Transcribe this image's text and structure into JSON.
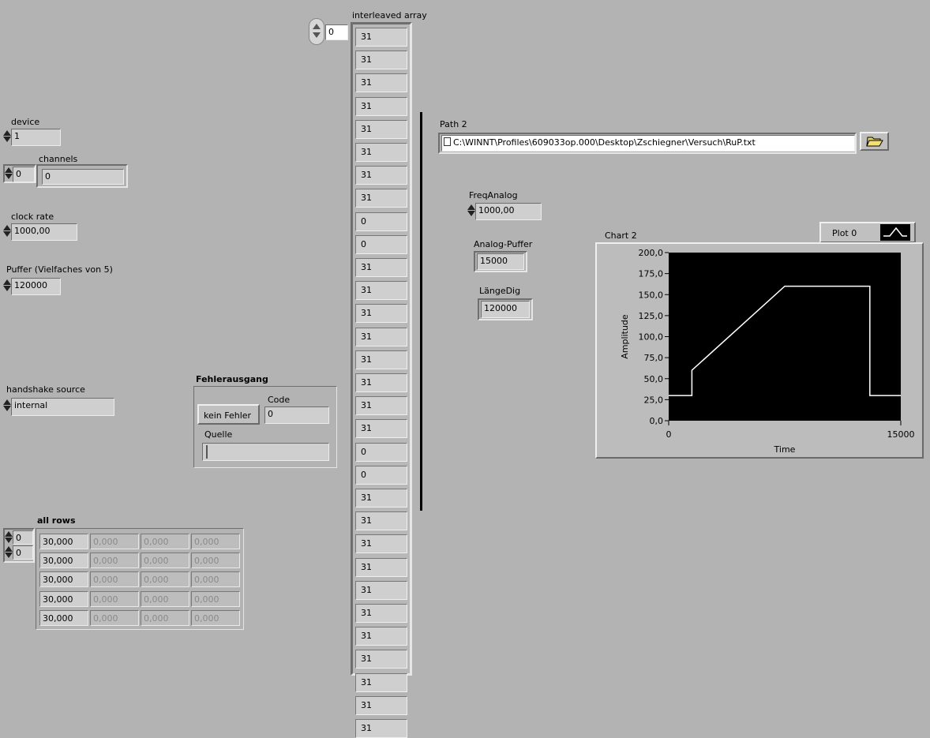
{
  "device": {
    "label": "device",
    "value": "1"
  },
  "channels": {
    "label": "channels",
    "index": "0",
    "value": "0"
  },
  "clock_rate": {
    "label": "clock rate",
    "value": "1000,00"
  },
  "puffer": {
    "label": "Puffer (Vielfaches von 5)",
    "value": "120000"
  },
  "handshake": {
    "label": "handshake source",
    "value": "internal"
  },
  "error_cluster": {
    "title": "Fehlerausgang",
    "code_label": "Code",
    "code_value": "0",
    "status_label": "kein Fehler",
    "source_label": "Quelle",
    "source_value": ""
  },
  "all_rows": {
    "label": "all rows",
    "index_row": "0",
    "index_col": "0",
    "rows": [
      [
        "30,000",
        "0,000",
        "0,000",
        "0,000"
      ],
      [
        "30,000",
        "0,000",
        "0,000",
        "0,000"
      ],
      [
        "30,000",
        "0,000",
        "0,000",
        "0,000"
      ],
      [
        "30,000",
        "0,000",
        "0,000",
        "0,000"
      ],
      [
        "30,000",
        "0,000",
        "0,000",
        "0,000"
      ]
    ]
  },
  "interleaved": {
    "label": "interleaved array",
    "index": "0",
    "values": [
      "31",
      "31",
      "31",
      "31",
      "31",
      "31",
      "31",
      "31",
      "0",
      "0",
      "31",
      "31",
      "31",
      "31",
      "31",
      "31",
      "31",
      "31",
      "0",
      "0",
      "31",
      "31",
      "31",
      "31",
      "31",
      "31",
      "31",
      "31",
      "31",
      "31",
      "31"
    ]
  },
  "path2": {
    "label": "Path 2",
    "value": "C:\\WINNT\\Profiles\\609033op.000\\Desktop\\Zschiegner\\Versuch\\RuP.txt",
    "browse_icon": "folder-open-icon"
  },
  "freq_analog": {
    "label": "FreqAnalog",
    "value": "1000,00"
  },
  "analog_puffer": {
    "label": "Analog-Puffer",
    "value": "15000"
  },
  "laenge_dig": {
    "label": "LängeDig",
    "value": "120000"
  },
  "chart_data": {
    "type": "line",
    "title": "Chart 2",
    "legend": {
      "entries": [
        "Plot 0"
      ],
      "placement": "top-right"
    },
    "xlabel": "Time",
    "ylabel": "Amplitude",
    "xlim": [
      0,
      15000
    ],
    "ylim": [
      0,
      200
    ],
    "x_ticks": [
      "0",
      "15000"
    ],
    "y_ticks": [
      "0,0",
      "25,0",
      "50,0",
      "75,0",
      "100,0",
      "125,0",
      "150,0",
      "175,0",
      "200,0"
    ],
    "grid": false,
    "background": "#000000",
    "line_color": "#ffffff",
    "series": [
      {
        "name": "Plot 0",
        "x": [
          0,
          1500,
          1500,
          7500,
          13000,
          13000,
          15000
        ],
        "y": [
          30,
          30,
          60,
          160,
          160,
          30,
          30
        ]
      }
    ]
  }
}
